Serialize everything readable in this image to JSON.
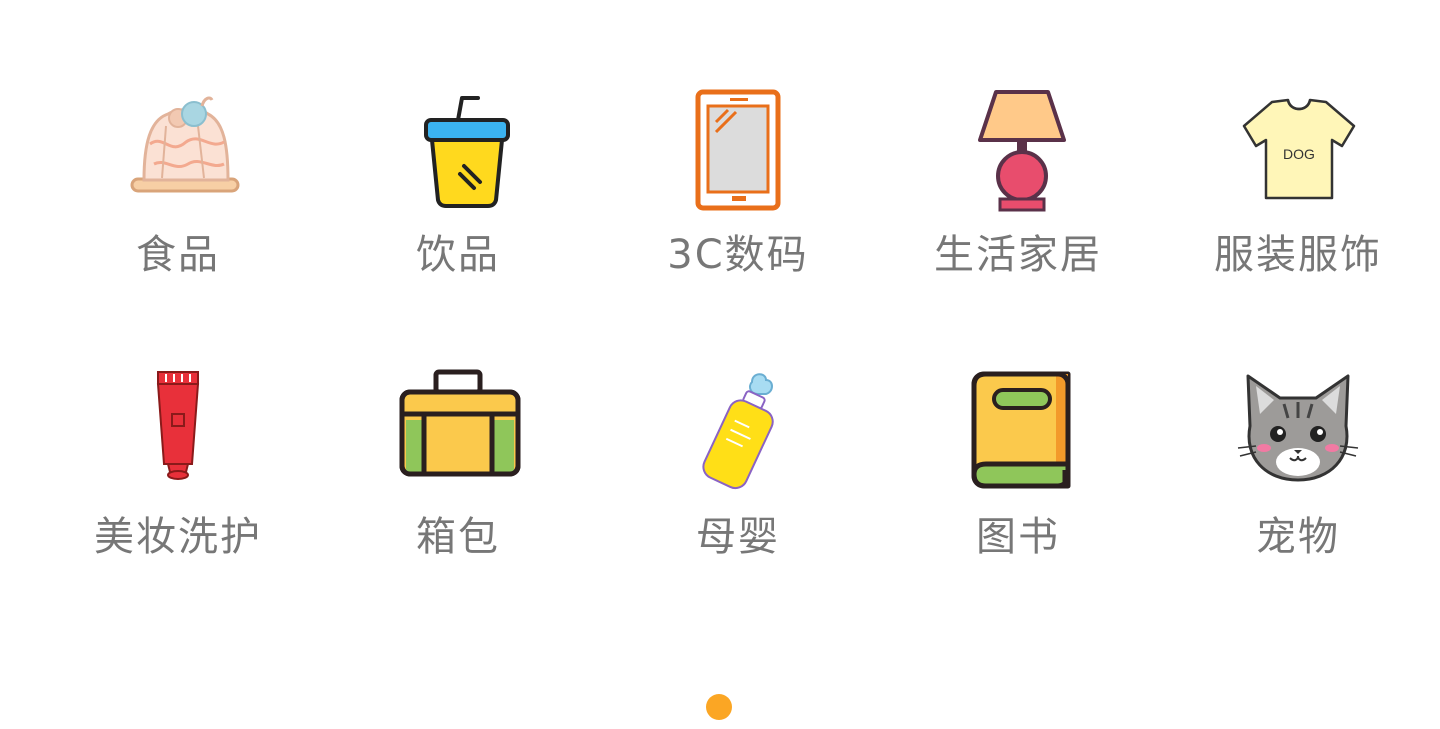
{
  "categories": [
    {
      "label": "食品",
      "icon": "pudding-icon"
    },
    {
      "label": "饮品",
      "icon": "drink-cup-icon"
    },
    {
      "label": "3C数码",
      "icon": "tablet-icon"
    },
    {
      "label": "生活家居",
      "icon": "table-lamp-icon"
    },
    {
      "label": "服装服饰",
      "icon": "tshirt-icon"
    },
    {
      "label": "美妆洗护",
      "icon": "cosmetic-tube-icon"
    },
    {
      "label": "箱包",
      "icon": "suitcase-icon"
    },
    {
      "label": "母婴",
      "icon": "baby-bottle-icon"
    },
    {
      "label": "图书",
      "icon": "book-icon"
    },
    {
      "label": "宠物",
      "icon": "cat-icon"
    }
  ],
  "tshirt_print": "DOG",
  "pager": {
    "current_page": 1,
    "active_color": "#fba624"
  }
}
